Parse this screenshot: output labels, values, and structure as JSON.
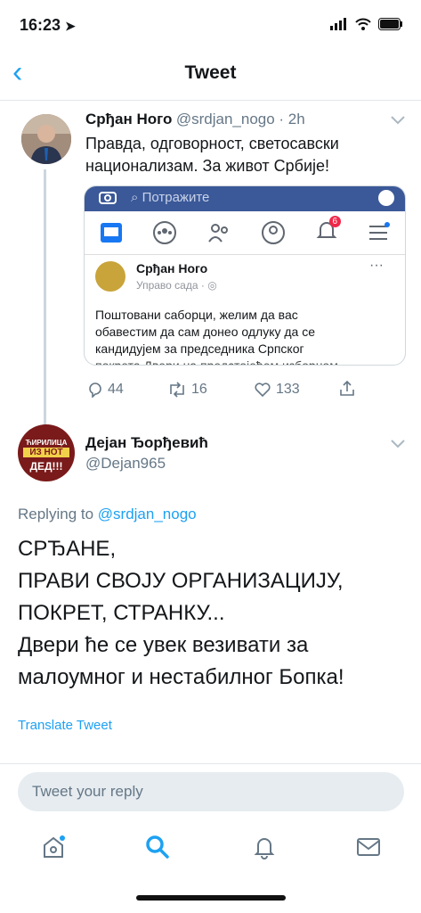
{
  "status": {
    "time": "16:23"
  },
  "nav": {
    "title": "Tweet"
  },
  "tweet1": {
    "name": "Срђан Ного",
    "handle": "@srdjan_nogo · 2h",
    "text_line1": "Правда, одговорност, светосавски",
    "text_line2": "национализам. За живот Србије!",
    "actions": {
      "replies": "44",
      "retweets": "16",
      "likes": "133"
    }
  },
  "card": {
    "search_placeholder": "Потражите",
    "notif_badge": "6",
    "post_name": "Срђан Ного",
    "post_meta": "Управо сада · ",
    "post_line1": "Поштовани саборци, желим да вас",
    "post_line2": "обавестим да сам донео одлуку да се",
    "post_line3": "кандидујем за председника Српског",
    "post_line4": "покрета Двери на предстојећем изборном",
    "more": "···"
  },
  "tweet2": {
    "name": "Дејан Ђорђевић",
    "handle": "@Dejan965",
    "avatar_text1": "ЋИРИЛИЦА",
    "avatar_text2": "ИЗ НОТ",
    "avatar_text3": "ДЕД!!!",
    "replying_prefix": "Replying to ",
    "replying_handle": "@srdjan_nogo",
    "line1": "СРЂАНЕ,",
    "line2": "ПРАВИ СВОЈУ ОРГАНИЗАЦИЈУ,",
    "line3": "ПОКРЕТ, СТРАНКУ...",
    "line4": "Двери ће се увек везивати за",
    "line5": "малоумног и нестабилног Бопка!",
    "translate": "Translate Tweet"
  },
  "reply": {
    "placeholder": "Tweet your reply"
  },
  "colors": {
    "accent": "#1da1f2",
    "facebook": "#3b5998"
  }
}
